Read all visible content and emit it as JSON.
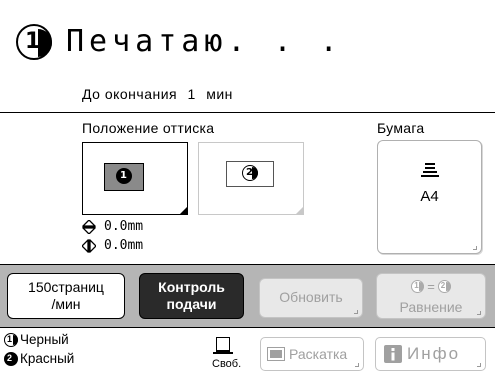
{
  "status": {
    "drum_number": "1",
    "title": "Печатаю. . .",
    "remaining_label": "До окончания",
    "remaining_value": "1",
    "remaining_unit": "мин"
  },
  "position": {
    "label": "Положение оттиска",
    "drum1_number": "1",
    "drum2_number": "2",
    "vertical_offset": "0.0mm",
    "horizontal_offset": "0.0mm"
  },
  "paper": {
    "label": "Бумага",
    "size": "A4",
    "icon": "paper-stack-icon"
  },
  "actions": {
    "speed_line1": "150страниц",
    "speed_line2": "/мин",
    "feed_line1": "Контроль",
    "feed_line2": "подачи",
    "update": "Обновить",
    "balance_icon_left": "1",
    "balance_icon_right": "2",
    "balance_label": "Равнение"
  },
  "bottom": {
    "drum1_number": "1",
    "drum1_color": "Черный",
    "drum2_number": "2",
    "drum2_color": "Красный",
    "memory_label": "Своб.",
    "memory_icon": "memory-icon",
    "preview": "Раскатка",
    "info": "Инфо"
  },
  "colors": {
    "action_bar": "#b5b5b5",
    "dark_button": "#2a2a2a",
    "disabled_text": "#a0a0a0",
    "drum1_chip": "#8a8a8a"
  }
}
